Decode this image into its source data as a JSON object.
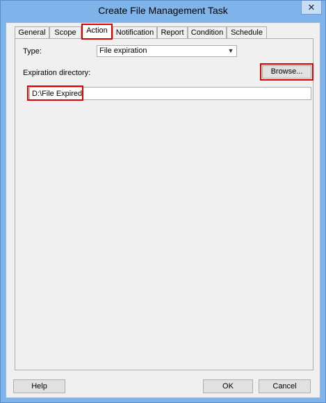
{
  "window": {
    "title": "Create File Management Task",
    "close_glyph": "✕"
  },
  "tabs": [
    {
      "label": "General"
    },
    {
      "label": "Scope"
    },
    {
      "label": "Action",
      "active": true
    },
    {
      "label": "Notification"
    },
    {
      "label": "Report"
    },
    {
      "label": "Condition"
    },
    {
      "label": "Schedule"
    }
  ],
  "action": {
    "type_label": "Type:",
    "type_value": "File expiration",
    "dir_label": "Expiration directory:",
    "browse_label": "Browse...",
    "dir_value": "D:\\File Expired"
  },
  "footer": {
    "help": "Help",
    "ok": "OK",
    "cancel": "Cancel"
  },
  "colors": {
    "highlight": "#e00000",
    "frame": "#7eb4ea"
  }
}
